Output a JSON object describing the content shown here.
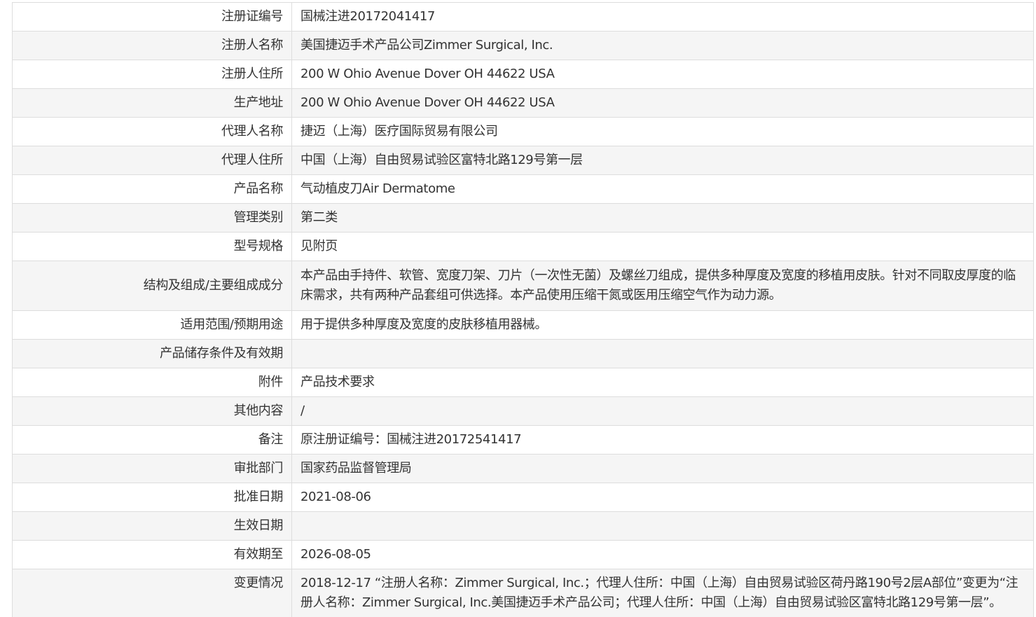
{
  "rows": [
    {
      "label": "注册证编号",
      "value": "国械注进20172041417"
    },
    {
      "label": "注册人名称",
      "value": "美国捷迈手术产品公司Zimmer Surgical, Inc."
    },
    {
      "label": "注册人住所",
      "value": "200 W Ohio Avenue Dover OH 44622 USA"
    },
    {
      "label": "生产地址",
      "value": "200 W Ohio Avenue Dover OH 44622 USA"
    },
    {
      "label": "代理人名称",
      "value": "捷迈（上海）医疗国际贸易有限公司"
    },
    {
      "label": "代理人住所",
      "value": "中国（上海）自由贸易试验区富特北路129号第一层"
    },
    {
      "label": "产品名称",
      "value": "气动植皮刀Air Dermatome"
    },
    {
      "label": "管理类别",
      "value": "第二类"
    },
    {
      "label": "型号规格",
      "value": "见附页"
    },
    {
      "label": "结构及组成/主要组成成分",
      "value": "本产品由手持件、软管、宽度刀架、刀片（一次性无菌）及螺丝刀组成，提供多种厚度及宽度的移植用皮肤。针对不同取皮厚度的临床需求，共有两种产品套组可供选择。本产品使用压缩干氮或医用压缩空气作为动力源。"
    },
    {
      "label": "适用范围/预期用途",
      "value": "用于提供多种厚度及宽度的皮肤移植用器械。"
    },
    {
      "label": "产品储存条件及有效期",
      "value": ""
    },
    {
      "label": "附件",
      "value": "产品技术要求"
    },
    {
      "label": "其他内容",
      "value": "/"
    },
    {
      "label": "备注",
      "value": "原注册证编号：国械注进20172541417"
    },
    {
      "label": "审批部门",
      "value": "国家药品监督管理局"
    },
    {
      "label": "批准日期",
      "value": "2021-08-06"
    },
    {
      "label": "生效日期",
      "value": ""
    },
    {
      "label": "有效期至",
      "value": "2026-08-05"
    },
    {
      "label": "变更情况",
      "value": "2018-12-17 “注册人名称：Zimmer Surgical, Inc.；代理人住所：中国（上海）自由贸易试验区荷丹路190号2层A部位”变更为“注册人名称：Zimmer Surgical, Inc.美国捷迈手术产品公司；代理人住所：中国（上海）自由贸易试验区富特北路129号第一层”。"
    }
  ]
}
